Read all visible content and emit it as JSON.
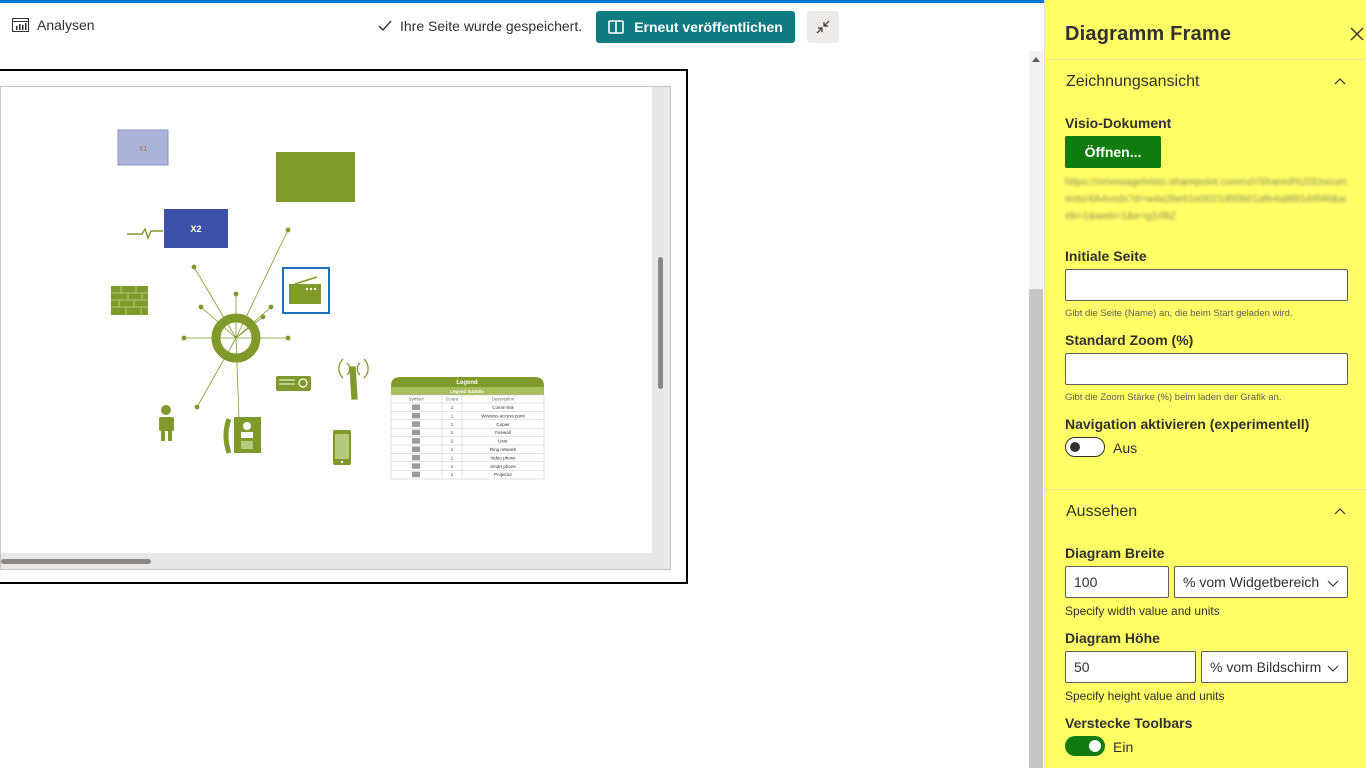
{
  "toolbar": {
    "analytics_label": "Analysen",
    "saved_status": "Ihre Seite wurde gespeichert.",
    "publish_label": "Erneut veröffentlichen",
    "collapse_icon": "collapse-icon"
  },
  "diagram": {
    "shape_x1_label": "X1",
    "shape_x2_label": "X2",
    "legend": {
      "title": "Legend",
      "subtitle": "Legend Subtitle",
      "columns": [
        "Symbol",
        "Count",
        "Description"
      ],
      "rows": [
        {
          "count": "1",
          "description": "Comm-link"
        },
        {
          "count": "1",
          "description": "Wireless access point"
        },
        {
          "count": "1",
          "description": "Copier"
        },
        {
          "count": "1",
          "description": "Firewall"
        },
        {
          "count": "1",
          "description": "User"
        },
        {
          "count": "1",
          "description": "Ring network"
        },
        {
          "count": "1",
          "description": "Video phone"
        },
        {
          "count": "1",
          "description": "Smart phone"
        },
        {
          "count": "1",
          "description": "Projector"
        }
      ]
    },
    "colors": {
      "olive": "#7f9a2a",
      "blue": "#3b52a8",
      "lightblue": "#aab4d8",
      "selection": "#1f6fbf"
    }
  },
  "panel": {
    "title": "Diagramm Frame",
    "section1": {
      "title": "Zeichnungsansicht",
      "visio_label": "Visio-Dokument",
      "open_label": "Öffnen...",
      "url_blurred": "https://ommsagelvisio.sharepoint.com/u/r/Shared%20Documents/4A4vsdx?d=w4a2be61e0021d00b01afe4a8f81d4f46&web=1&web=1&e=g1rf8Z",
      "initial_page_label": "Initiale Seite",
      "initial_page_value": "",
      "initial_page_hint": "Gibt die Seite (Name) an, die beim Start geladen wird.",
      "zoom_label": "Standard Zoom (%)",
      "zoom_value": "",
      "zoom_hint": "Gibt die Zoom Stärke (%) beim laden der Grafik an.",
      "nav_label": "Navigation aktivieren (experimentell)",
      "nav_state": "Aus"
    },
    "section2": {
      "title": "Aussehen",
      "width_label": "Diagram Breite",
      "width_value": "100",
      "width_unit": "% vom Widgetbereich",
      "width_hint": "Specify width value and units",
      "height_label": "Diagram Höhe",
      "height_value": "50",
      "height_unit": "% vom Bildschirm",
      "height_hint": "Specify height value and units",
      "toolbars_label": "Verstecke Toolbars",
      "toolbars_state": "Ein"
    }
  }
}
